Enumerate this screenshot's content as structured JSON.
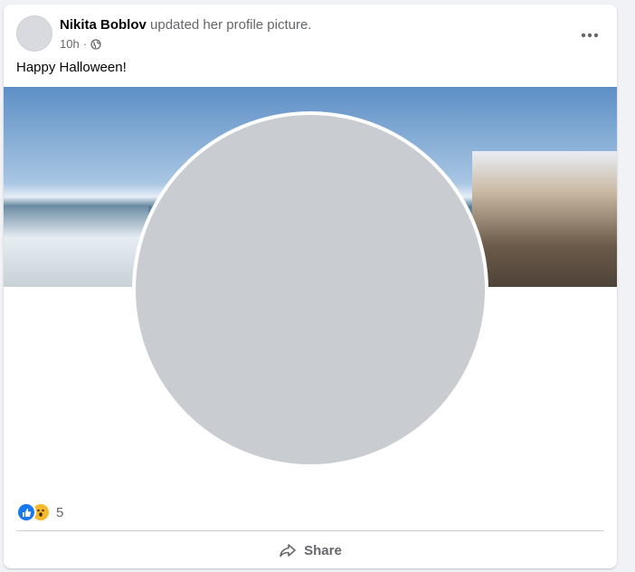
{
  "post": {
    "author": "Nikita Boblov",
    "action": "updated her profile picture.",
    "time": "10h",
    "privacy_icon": "globe-icon",
    "more_icon": "more-options-icon",
    "caption": "Happy Halloween!"
  },
  "reactions": {
    "icons": [
      "like-icon",
      "wow-icon"
    ],
    "count": "5"
  },
  "actions": {
    "share_label": "Share",
    "share_icon": "share-icon"
  },
  "colors": {
    "background": "#f0f2f5",
    "card": "#ffffff",
    "primary_text": "#050505",
    "secondary_text": "#65676b",
    "like_blue": "#1877f2",
    "wow_yellow": "#f7b928"
  }
}
